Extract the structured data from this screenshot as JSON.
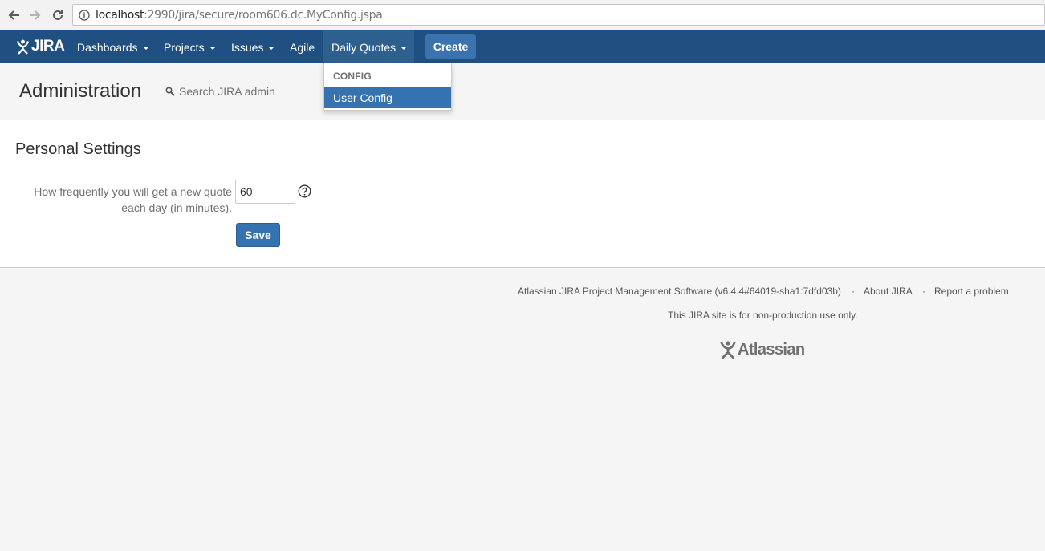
{
  "browser": {
    "url_host": "localhost",
    "url_rest": ":2990/jira/secure/room606.dc.MyConfig.jspa",
    "icons": [
      "back-arrow-icon",
      "forward-arrow-icon",
      "reload-icon",
      "info-icon"
    ]
  },
  "header": {
    "logo_text": "JIRA",
    "nav": {
      "dashboards": "Dashboards",
      "projects": "Projects",
      "issues": "Issues",
      "agile": "Agile",
      "daily_quotes": "Daily Quotes"
    },
    "create_label": "Create",
    "colors": {
      "bar": "#205081",
      "active": "#2d5f8f",
      "create": "#3b73af"
    }
  },
  "dropdown": {
    "heading": "CONFIG",
    "item": "User Config",
    "item_color": "#3572b0"
  },
  "admin": {
    "title": "Administration",
    "search_label": "Search JIRA admin"
  },
  "content": {
    "section_title": "Personal Settings",
    "field_label_line1": "How frequently you will get a new quote",
    "field_label_line2": "each day (in minutes).",
    "field_value": "60",
    "save_label": "Save"
  },
  "footer": {
    "version": "Atlassian JIRA Project Management Software (v6.4.4#64019-sha1:7dfd03b)",
    "sep": "·",
    "about": "About JIRA",
    "report": "Report a problem",
    "note": "This JIRA site is for non-production use only.",
    "atlassian": "Atlassian"
  }
}
